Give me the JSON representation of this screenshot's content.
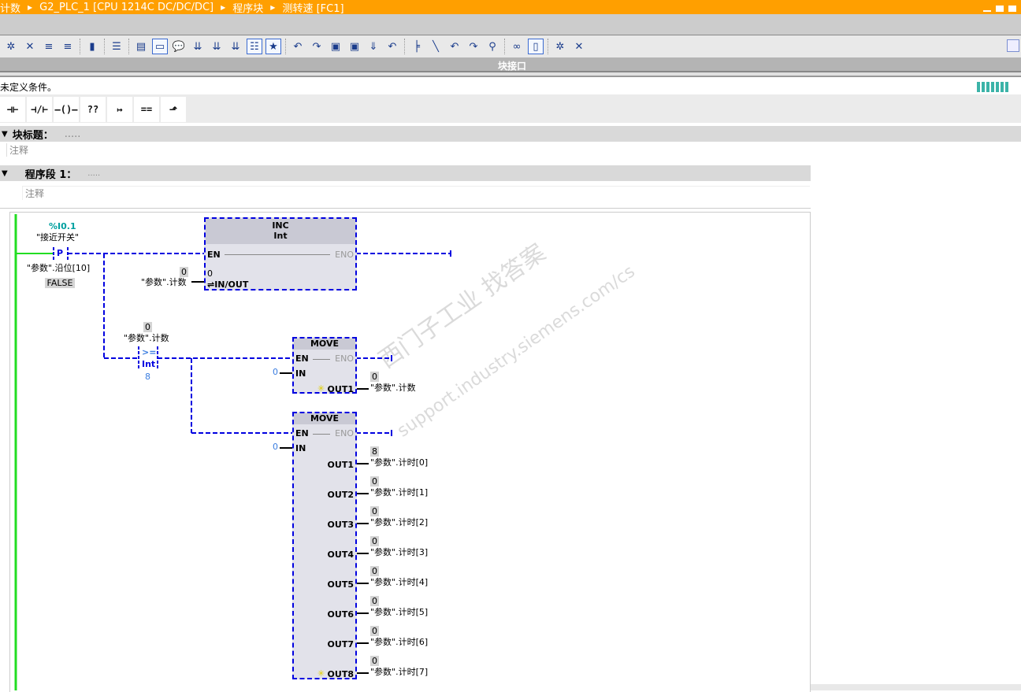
{
  "title_bar": {
    "breadcrumb": [
      "计数",
      "G2_PLC_1 [CPU 1214C DC/DC/DC]",
      "程序块",
      "测转速 [FC1]"
    ]
  },
  "toolbar": {
    "icons": [
      "insert-network-icon",
      "delete-network-icon",
      "insert-row-icon",
      "add-row-icon",
      "interface-icon",
      "collapse-icon",
      "absolute-operands-icon",
      "network-view-icon",
      "comments-icon",
      "favorites-icon",
      "show-symbols-icon",
      "symbol-info-icon",
      "show-sorted-icon",
      "open-all-networks-icon",
      "close-all-networks-icon",
      "go-to-error-icon",
      "previous-error-icon",
      "monitor-icon",
      "next-error-icon",
      "update-icon",
      "download-icon",
      "jump-icon",
      "insert-jump-icon",
      "remove-jump-icon",
      "back-icon",
      "forward-icon",
      "reference-icon",
      "monitoring-on-icon",
      "database-icon"
    ]
  },
  "interface_bar": {
    "label": "块接口"
  },
  "condition_text": "未定义条件。",
  "lad_palette": [
    {
      "name": "no-contact",
      "glyph": "⊣⊢"
    },
    {
      "name": "nc-contact",
      "glyph": "⊣/⊢"
    },
    {
      "name": "coil",
      "glyph": "—()—"
    },
    {
      "name": "empty-box",
      "glyph": "??"
    },
    {
      "name": "open-branch",
      "glyph": "↦"
    },
    {
      "name": "compare",
      "glyph": "=="
    },
    {
      "name": "close-branch",
      "glyph": "⬏"
    }
  ],
  "block_title": {
    "label": "块标题：",
    "value": ".....",
    "comment": "注释"
  },
  "network1": {
    "label": "程序段 1：",
    "value": ".....",
    "comment": "注释"
  },
  "ladder": {
    "contact": {
      "address": "%I0.1",
      "tag": "\"接近开关\"",
      "type": "P",
      "edge_bit": "\"参数\".沿位[10]",
      "edge_state": "FALSE"
    },
    "inc": {
      "name": "INC",
      "type": "Int",
      "en": "EN",
      "eno": "ENO",
      "inout_pin": "⇌IN/OUT",
      "inout_value": "0",
      "operand": "\"参数\".计数",
      "operand_value": "0"
    },
    "compare": {
      "op": ">=",
      "type": "Int",
      "operand1": "\"参数\".计数",
      "operand1_value": "0",
      "operand2": "8"
    },
    "move1": {
      "name": "MOVE",
      "en": "EN",
      "eno": "ENO",
      "in_pin": "IN",
      "in_value": "0",
      "outputs": [
        {
          "pin": "OUT1",
          "tag": "\"参数\".计数",
          "value": "0"
        }
      ]
    },
    "move2": {
      "name": "MOVE",
      "en": "EN",
      "eno": "ENO",
      "in_pin": "IN",
      "in_value": "0",
      "outputs": [
        {
          "pin": "OUT1",
          "tag": "\"参数\".计时[0]",
          "value": "8"
        },
        {
          "pin": "OUT2",
          "tag": "\"参数\".计时[1]",
          "value": "0"
        },
        {
          "pin": "OUT3",
          "tag": "\"参数\".计时[2]",
          "value": "0"
        },
        {
          "pin": "OUT4",
          "tag": "\"参数\".计时[3]",
          "value": "0"
        },
        {
          "pin": "OUT5",
          "tag": "\"参数\".计时[4]",
          "value": "0"
        },
        {
          "pin": "OUT6",
          "tag": "\"参数\".计时[5]",
          "value": "0"
        },
        {
          "pin": "OUT7",
          "tag": "\"参数\".计时[6]",
          "value": "0"
        },
        {
          "pin": "OUT8",
          "tag": "\"参数\".计时[7]",
          "value": "0"
        }
      ]
    }
  },
  "watermark": {
    "line1": "西门子工业  找答案",
    "line2": "support.industry.siemens.com/cs"
  },
  "colors": {
    "title": "#ff9f00",
    "power_rail": "#22dd22",
    "rlo_false": "#0000e0",
    "address": "#00a0a0"
  }
}
